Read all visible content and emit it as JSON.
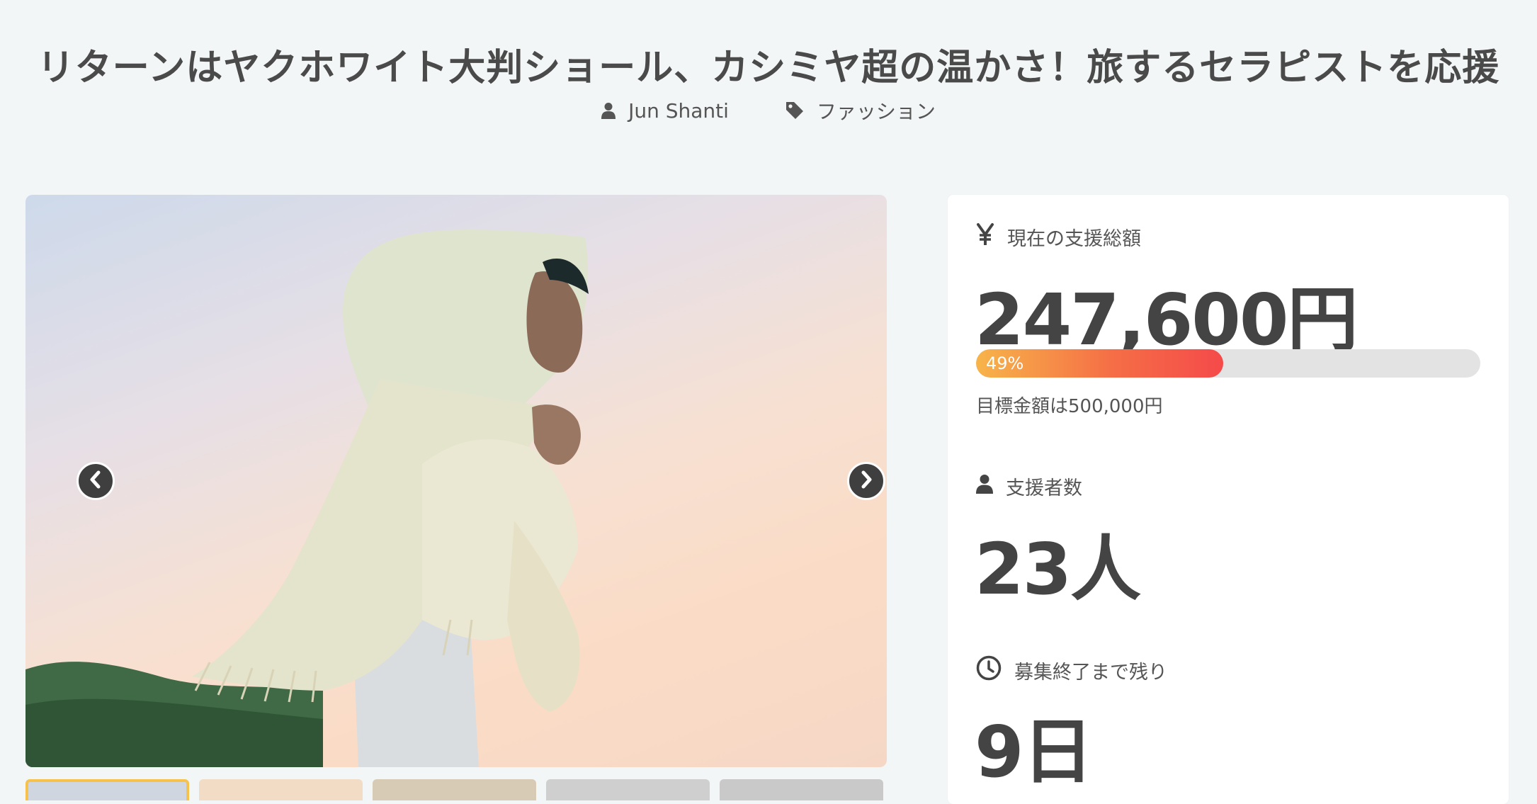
{
  "header": {
    "title": "リターンはヤクホワイト大判ショール、カシミヤ超の温かさ！旅するセラピストを応援",
    "author": "Jun Shanti",
    "category": "ファッション"
  },
  "carousel": {
    "image_alt": "Woman wrapped in a large white shawl against a pastel sky",
    "prev_icon": "chevron-left-icon",
    "next_icon": "chevron-right-icon",
    "thumbnail_count": 5
  },
  "stats": {
    "total": {
      "icon": "yen-icon",
      "label": "現在の支援総額",
      "value": "247,600円",
      "progress_percent": 49,
      "progress_label": "49%",
      "goal_text": "目標金額は500,000円"
    },
    "supporters": {
      "icon": "person-icon",
      "label": "支援者数",
      "value": "23人"
    },
    "remaining": {
      "icon": "clock-icon",
      "label": "募集終了まで残り",
      "value": "9日"
    }
  },
  "colors": {
    "background": "#f3f6f7",
    "text": "#444444",
    "progress_start": "#f7b44a",
    "progress_end": "#f54a4a",
    "active_thumb_border": "#f6c24b"
  }
}
